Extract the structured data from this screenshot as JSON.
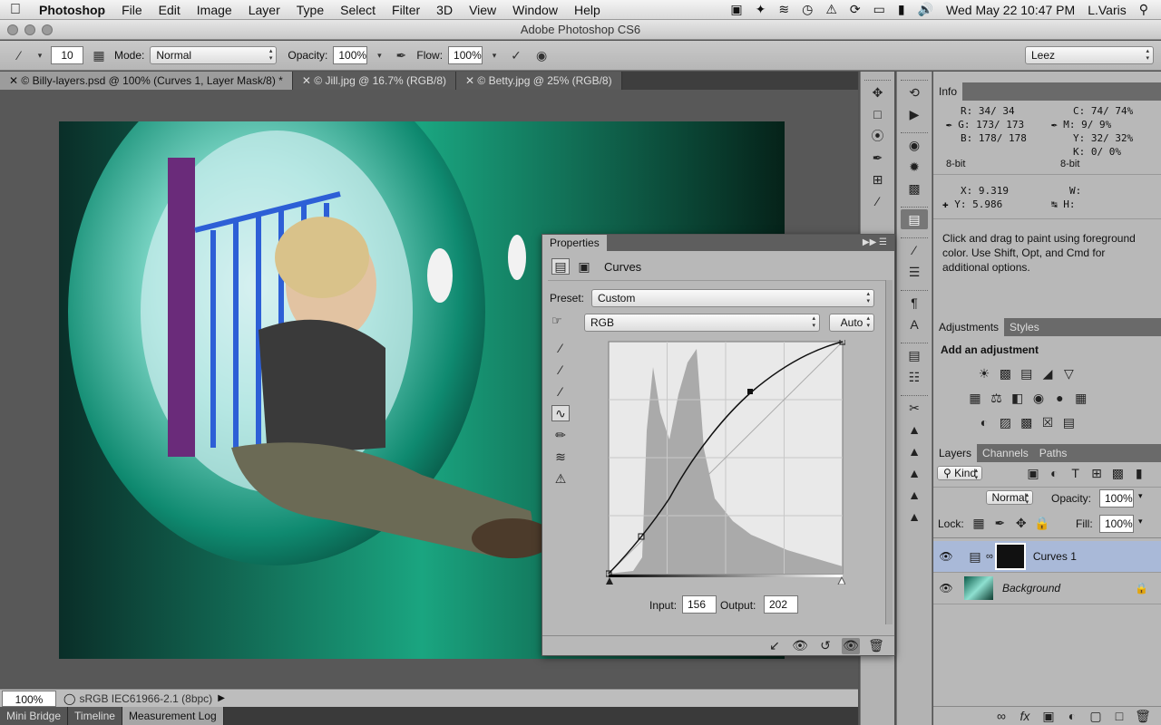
{
  "menubar": {
    "app": "Photoshop",
    "items": [
      "File",
      "Edit",
      "Image",
      "Layer",
      "Type",
      "Select",
      "Filter",
      "3D",
      "View",
      "Window",
      "Help"
    ],
    "datetime": "Wed May 22  10:47 PM",
    "user": "L.Varis"
  },
  "window": {
    "title": "Adobe Photoshop CS6"
  },
  "options": {
    "brush_size": "10",
    "mode_label": "Mode:",
    "mode_value": "Normal",
    "opacity_label": "Opacity:",
    "opacity_value": "100%",
    "flow_label": "Flow:",
    "flow_value": "100%",
    "workspace": "Leez"
  },
  "doc_tabs": [
    "Billy-layers.psd @ 100% (Curves 1, Layer Mask/8) *",
    "Jill.jpg @ 16.7% (RGB/8)",
    "Betty.jpg @ 25% (RGB/8)"
  ],
  "status": {
    "zoom": "100%",
    "profile": "sRGB IEC61966-2.1 (8bpc)"
  },
  "bottom_tabs": [
    "Mini Bridge",
    "Timeline",
    "Measurement Log"
  ],
  "info": {
    "tab": "Info",
    "rgb": {
      "R": "34/  34",
      "G": "173/ 173",
      "B": "178/ 178"
    },
    "cmyk": {
      "C": "74/  74%",
      "M": "9/   9%",
      "Y": "32/  32%",
      "K": "0/   0%"
    },
    "bitdepth_left": "8-bit",
    "bitdepth_right": "8-bit",
    "X": "9.319",
    "Y": "5.986",
    "W": "",
    "H": "",
    "hint": "Click and drag to paint using foreground color.  Use Shift, Opt, and Cmd for additional options."
  },
  "adjustments": {
    "tabs": [
      "Adjustments",
      "Styles"
    ],
    "heading": "Add an adjustment"
  },
  "layers": {
    "tabs": [
      "Layers",
      "Channels",
      "Paths"
    ],
    "filter": "Kind",
    "blend": "Normal",
    "opacity_label": "Opacity:",
    "opacity": "100%",
    "lock_label": "Lock:",
    "fill_label": "Fill:",
    "fill": "100%",
    "items": [
      {
        "name": "Curves 1",
        "selected": true
      },
      {
        "name": "Background",
        "selected": false
      }
    ]
  },
  "properties": {
    "tab": "Properties",
    "title": "Curves",
    "preset_label": "Preset:",
    "preset_value": "Custom",
    "channel_value": "RGB",
    "auto_label": "Auto",
    "input_label": "Input:",
    "input_value": "156",
    "output_label": "Output:",
    "output_value": "202"
  },
  "colors": {
    "selected_layer": "#a9b9d8",
    "panel": "#b8b8b8",
    "dark": "#535353"
  }
}
